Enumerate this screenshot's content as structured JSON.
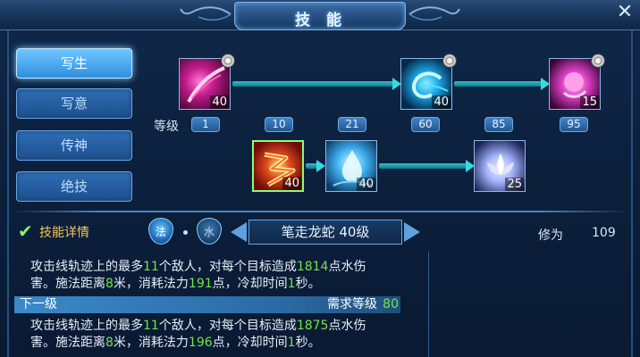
{
  "window": {
    "title": "技 能",
    "close_glyph": "✕"
  },
  "tabs": [
    {
      "label": "写生",
      "active": true
    },
    {
      "label": "写意",
      "active": false
    },
    {
      "label": "传神",
      "active": false
    },
    {
      "label": "绝技",
      "active": false
    }
  ],
  "tree": {
    "level_label": "等级",
    "levels": [
      "1",
      "10",
      "21",
      "60",
      "85",
      "95"
    ],
    "skills": [
      {
        "icon": "pink-slash-icon",
        "level": "40",
        "has_ring": true
      },
      {
        "icon": "cyan-swirl-icon",
        "level": "40",
        "has_ring": true
      },
      {
        "icon": "magenta-orb-icon",
        "level": "15",
        "has_ring": true
      },
      {
        "icon": "fire-lightning-icon",
        "level": "40",
        "has_ring": false,
        "selected": true
      },
      {
        "icon": "water-drop-icon",
        "level": "40",
        "has_ring": false
      },
      {
        "icon": "lotus-burst-icon",
        "level": "25",
        "has_ring": false
      }
    ]
  },
  "detail": {
    "title": "技能详情",
    "badge_fa": "法",
    "badge_shui": "水",
    "skill_name": "笔走龙蛇 40级",
    "xiuwei_label": "修为",
    "xiuwei_value": "109",
    "current": {
      "p1": "攻击线轨迹上的最多",
      "targets": "11",
      "p2": "个敌人，对每个目标造成",
      "damage": "1814",
      "p3": "点水伤",
      "p4": "害。施法距离",
      "range": "8",
      "p5": "米，消耗法力",
      "mana": "191",
      "p6": "点，冷却时间",
      "cooldown": "1",
      "p7": "秒。"
    },
    "next_label": "下一级",
    "req_label": "需求等级",
    "req_value": "80",
    "next": {
      "p1": "攻击线轨迹上的最多",
      "targets": "11",
      "p2": "个敌人，对每个目标造成",
      "damage": "1875",
      "p3": "点水伤",
      "p4": "害。施法距离",
      "range": "8",
      "p5": "米，消耗法力",
      "mana": "196",
      "p6": "点，冷却时间",
      "cooldown": "1",
      "p7": "秒。"
    }
  },
  "colors": {
    "accent": "#3ad9e0",
    "highlight": "#74e24a",
    "title_gold": "#f4c85a"
  }
}
